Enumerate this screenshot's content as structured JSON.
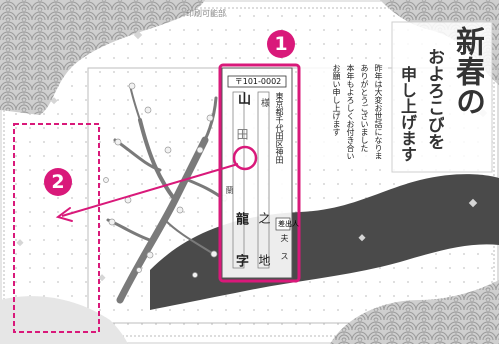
{
  "header": {
    "label": "印刷可能部"
  },
  "address_block": {
    "postal_code": "〒101-0002",
    "address_line": "東京都千代田区神田",
    "building_label": "差出人",
    "sender_name_fragment": "蘭",
    "recipient_chars": [
      "様",
      "様"
    ],
    "surname_chars": [
      "山",
      "田"
    ],
    "given_name_chars": [
      "龍",
      "字"
    ],
    "extra_chars": [
      "之",
      "地"
    ],
    "extra_fragment": "ス",
    "side_fragment": "夫"
  },
  "message_lines": [
    "昨年は大変お世話になりまして",
    "ありがとうございました",
    "本年もよろしくお付き合い",
    "お願い申し上げます"
  ],
  "greeting": {
    "title": "新春の",
    "line2": "およろこびを",
    "line3": "申し上げます"
  },
  "markers": {
    "one": "1",
    "two": "2"
  },
  "colors": {
    "accent": "#d9197a",
    "wave": "#4a4a4a",
    "seigaiha": "#b8b8b8"
  }
}
